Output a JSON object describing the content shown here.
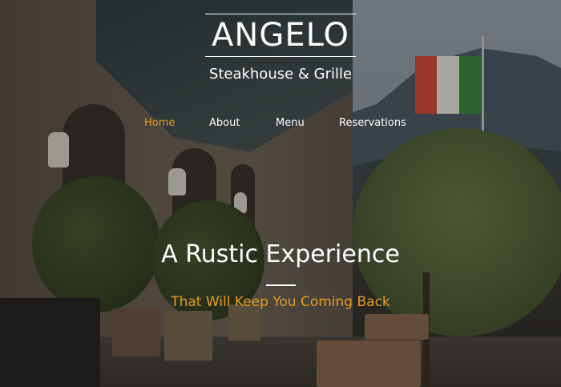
{
  "brand": {
    "title": "ANGELO",
    "subtitle": "Steakhouse & Grille"
  },
  "nav": {
    "items": [
      {
        "label": "Home",
        "active": true
      },
      {
        "label": "About",
        "active": false
      },
      {
        "label": "Menu",
        "active": false
      },
      {
        "label": "Reservations",
        "active": false
      }
    ]
  },
  "hero": {
    "headline": "A Rustic Experience",
    "tagline": "That Will Keep You Coming Back"
  },
  "colors": {
    "accent": "#e39b24",
    "text": "#ffffff",
    "overlay": "rgba(0,0,0,0.28)"
  }
}
